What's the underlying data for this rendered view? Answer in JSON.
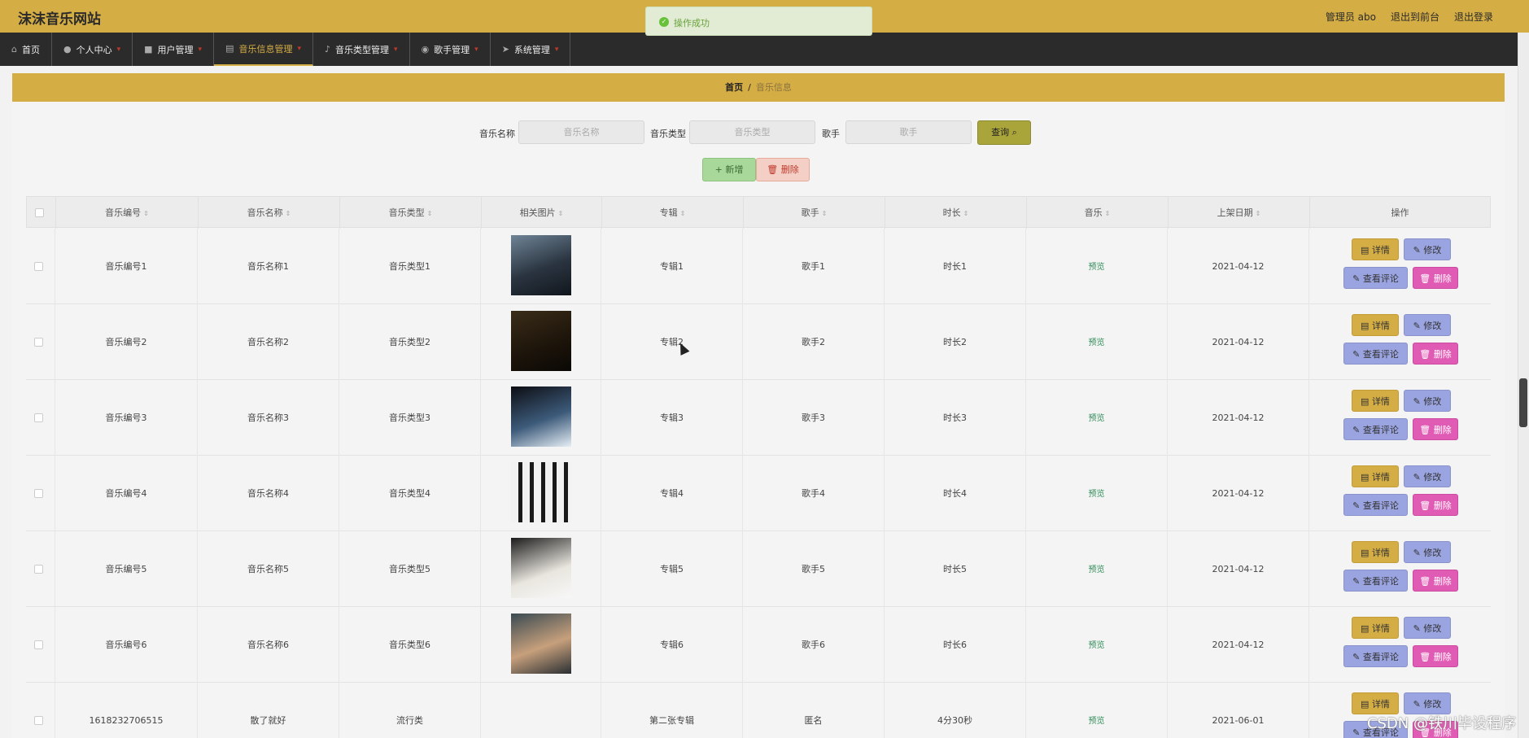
{
  "header": {
    "brand": "沫沫音乐网站",
    "admin": "管理员 abo",
    "back_front": "退出到前台",
    "logout": "退出登录"
  },
  "toast": {
    "text": "操作成功"
  },
  "nav": [
    {
      "label": "首页",
      "icon": "home-icon"
    },
    {
      "label": "个人中心",
      "icon": "user-icon"
    },
    {
      "label": "用户管理",
      "icon": "users-icon"
    },
    {
      "label": "音乐信息管理",
      "icon": "music-icon"
    },
    {
      "label": "音乐类型管理",
      "icon": "mic-icon"
    },
    {
      "label": "歌手管理",
      "icon": "singer-icon"
    },
    {
      "label": "系统管理",
      "icon": "send-icon"
    }
  ],
  "breadcrumb": {
    "home": "首页",
    "sep": "/",
    "current": "音乐信息"
  },
  "search": {
    "name_label": "音乐名称",
    "name_placeholder": "音乐名称",
    "type_label": "音乐类型",
    "type_placeholder": "音乐类型",
    "singer_label": "歌手",
    "singer_placeholder": "歌手",
    "query": "查询"
  },
  "actions": {
    "add": "+ 新增",
    "delete": "删除"
  },
  "table": {
    "headers": [
      "音乐编号",
      "音乐名称",
      "音乐类型",
      "相关图片",
      "专辑",
      "歌手",
      "时长",
      "音乐",
      "上架日期",
      "操作"
    ],
    "row_actions": {
      "detail": "详情",
      "edit": "修改",
      "comments": "查看评论",
      "delete": "删除"
    },
    "rows": [
      {
        "id": "音乐编号1",
        "name": "音乐名称1",
        "type": "音乐类型1",
        "album": "专辑1",
        "singer": "歌手1",
        "duration": "时长1",
        "music": "预览",
        "date": "2021-04-12"
      },
      {
        "id": "音乐编号2",
        "name": "音乐名称2",
        "type": "音乐类型2",
        "album": "专辑2",
        "singer": "歌手2",
        "duration": "时长2",
        "music": "预览",
        "date": "2021-04-12"
      },
      {
        "id": "音乐编号3",
        "name": "音乐名称3",
        "type": "音乐类型3",
        "album": "专辑3",
        "singer": "歌手3",
        "duration": "时长3",
        "music": "预览",
        "date": "2021-04-12"
      },
      {
        "id": "音乐编号4",
        "name": "音乐名称4",
        "type": "音乐类型4",
        "album": "专辑4",
        "singer": "歌手4",
        "duration": "时长4",
        "music": "预览",
        "date": "2021-04-12"
      },
      {
        "id": "音乐编号5",
        "name": "音乐名称5",
        "type": "音乐类型5",
        "album": "专辑5",
        "singer": "歌手5",
        "duration": "时长5",
        "music": "预览",
        "date": "2021-04-12"
      },
      {
        "id": "音乐编号6",
        "name": "音乐名称6",
        "type": "音乐类型6",
        "album": "专辑6",
        "singer": "歌手6",
        "duration": "时长6",
        "music": "预览",
        "date": "2021-04-12"
      },
      {
        "id": "1618232706515",
        "name": "散了就好",
        "type": "流行类",
        "album": "第二张专辑",
        "singer": "匿名",
        "duration": "4分30秒",
        "music": "预览",
        "date": "2021-06-01"
      }
    ]
  },
  "watermark": "CSDN @铁川毕设程序",
  "colors": {
    "primary": "#d4ad45",
    "nav_bg": "#2b2b2b"
  }
}
